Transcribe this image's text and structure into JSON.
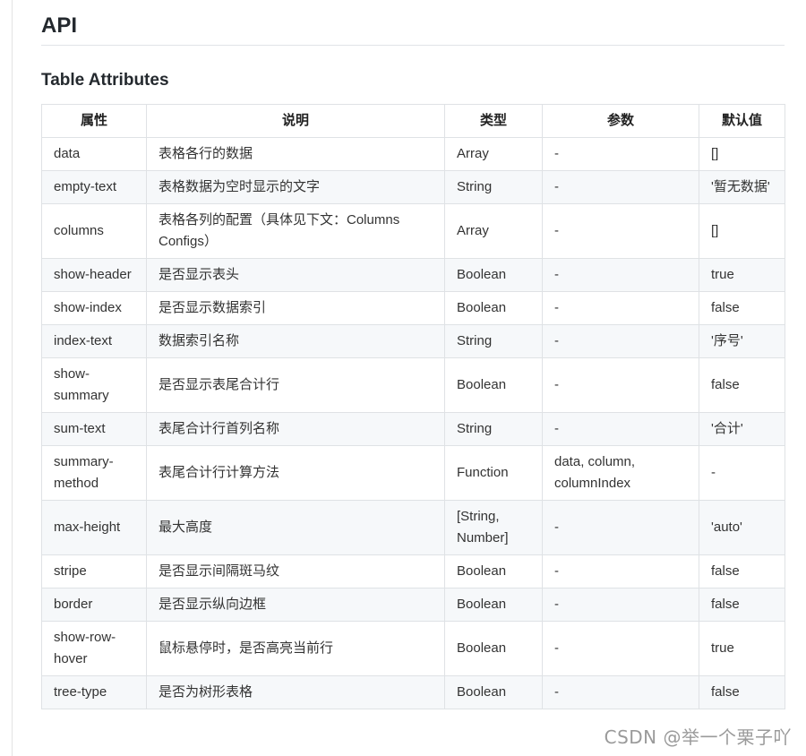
{
  "doc": {
    "title": "API",
    "subtitle": "Table Attributes"
  },
  "table": {
    "headers": [
      "属性",
      "说明",
      "类型",
      "参数",
      "默认值"
    ],
    "rows": [
      [
        "data",
        "表格各行的数据",
        "Array",
        "-",
        "[]"
      ],
      [
        "empty-text",
        "表格数据为空时显示的文字",
        "String",
        "-",
        "'暂无数据'"
      ],
      [
        "columns",
        "表格各列的配置（具体见下文：Columns Configs）",
        "Array",
        "-",
        "[]"
      ],
      [
        "show-header",
        "是否显示表头",
        "Boolean",
        "-",
        "true"
      ],
      [
        "show-index",
        "是否显示数据索引",
        "Boolean",
        "-",
        "false"
      ],
      [
        "index-text",
        "数据索引名称",
        "String",
        "-",
        "'序号'"
      ],
      [
        "show-summary",
        "是否显示表尾合计行",
        "Boolean",
        "-",
        "false"
      ],
      [
        "sum-text",
        "表尾合计行首列名称",
        "String",
        "-",
        "'合计'"
      ],
      [
        "summary-method",
        "表尾合计行计算方法",
        "Function",
        "data, column, columnIndex",
        "-"
      ],
      [
        "max-height",
        "最大高度",
        "[String, Number]",
        "-",
        "'auto'"
      ],
      [
        "stripe",
        "是否显示间隔斑马纹",
        "Boolean",
        "-",
        "false"
      ],
      [
        "border",
        "是否显示纵向边框",
        "Boolean",
        "-",
        "false"
      ],
      [
        "show-row-hover",
        "鼠标悬停时，是否高亮当前行",
        "Boolean",
        "-",
        "true"
      ],
      [
        "tree-type",
        "是否为树形表格",
        "Boolean",
        "-",
        "false"
      ]
    ]
  },
  "watermark": "CSDN @举一个栗子吖"
}
